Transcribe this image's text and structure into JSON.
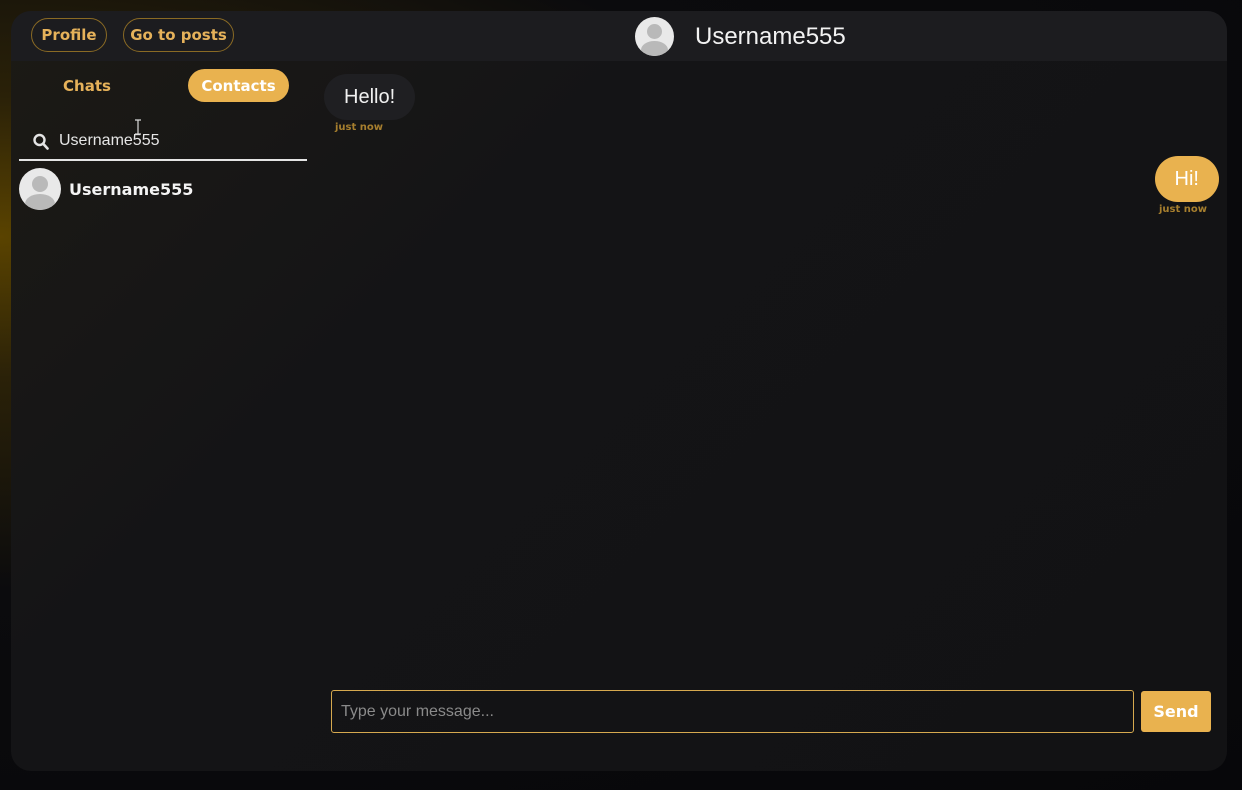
{
  "header": {
    "profile_label": "Profile",
    "posts_label": "Go to posts",
    "username": "Username555"
  },
  "sidebar": {
    "tabs": [
      {
        "label": "Chats",
        "active": false
      },
      {
        "label": "Contacts",
        "active": true
      }
    ],
    "search_value": "Username555",
    "contacts": [
      {
        "name": "Username555"
      }
    ]
  },
  "chat": {
    "messages": [
      {
        "text": "Hello!",
        "time": "just now",
        "direction": "incoming"
      },
      {
        "text": "Hi!",
        "time": "just now",
        "direction": "outgoing"
      }
    ],
    "input_placeholder": "Type your message...",
    "send_label": "Send"
  },
  "colors": {
    "accent": "#e9b24f",
    "background": "#121214",
    "topbar": "#1c1c1f",
    "timestamp": "#a77f2e"
  },
  "icons": [
    "search-icon",
    "avatar-icon",
    "text-cursor-icon"
  ]
}
